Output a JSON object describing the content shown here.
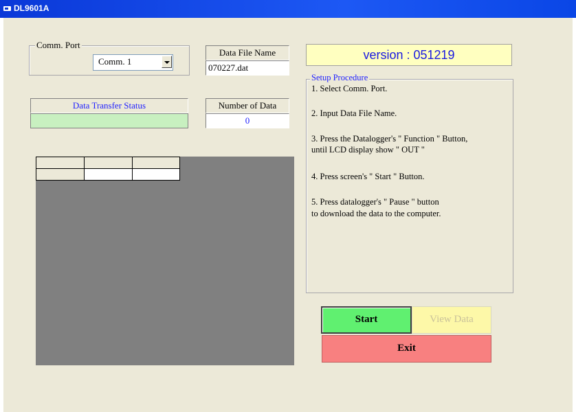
{
  "window": {
    "title": "DL9601A",
    "icon": "app-window-icon"
  },
  "comm_port": {
    "legend": "Comm. Port",
    "selected": "Comm. 1",
    "arrow_icon": "chevron-down-icon"
  },
  "data_file": {
    "label": "Data File Name",
    "value": "070227.dat"
  },
  "version": {
    "text": "version : 051219",
    "color": "#1a1ae0",
    "background": "#ffffc0"
  },
  "transfer_status": {
    "label": "Data Transfer Status",
    "label_color": "#2020ff",
    "value": "",
    "background": "#c8f0c0"
  },
  "number_of_data": {
    "label": "Number of  Data",
    "value": "0",
    "value_color": "#2020ff"
  },
  "data_grid": {
    "background": "#808080",
    "header_row": [
      "",
      "",
      ""
    ],
    "rows": [
      [
        "",
        "",
        ""
      ]
    ]
  },
  "setup": {
    "legend": "Setup Procedure",
    "legend_color": "#2020ff",
    "steps": [
      "1. Select Comm. Port.",
      "2. Input Data File Name.",
      "3. Press the Datalogger's \" Function \" Button,",
      "    until LCD display show \" OUT \"",
      "4. Press screen's \" Start \" Button.",
      "5. Press datalogger's  \" Pause \" button",
      "    to download the data to the computer."
    ]
  },
  "buttons": {
    "start": "Start",
    "view_data": "View Data",
    "exit": "Exit"
  },
  "colors": {
    "start": "#60f070",
    "view_data": "#fdf8a8",
    "exit": "#f88080",
    "form_background": "#ece9d8",
    "title_bar": "#0a38d8"
  }
}
